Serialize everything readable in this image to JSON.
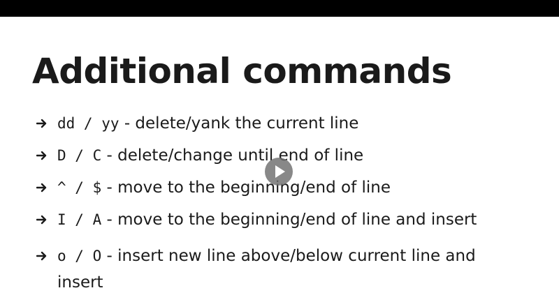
{
  "slide": {
    "title": "Additional commands",
    "items": [
      {
        "keys": "dd / yy",
        "description": " - delete/yank the current line"
      },
      {
        "keys": "D / C",
        "description": " - delete/change until end of line"
      },
      {
        "keys": "^ / $",
        "description": " - move to the beginning/end of line"
      },
      {
        "keys": "I / A",
        "description": " - move to the beginning/end of line and insert"
      },
      {
        "keys": "o / O",
        "description": " - insert new line above/below current line and insert"
      }
    ]
  },
  "colors": {
    "top_bar": "#000000",
    "background": "#ffffff",
    "text": "#1a1a1a",
    "play_button": "#6e6e6e"
  },
  "icons": {
    "bullet": "arrow-right-icon",
    "player": "play-icon"
  }
}
